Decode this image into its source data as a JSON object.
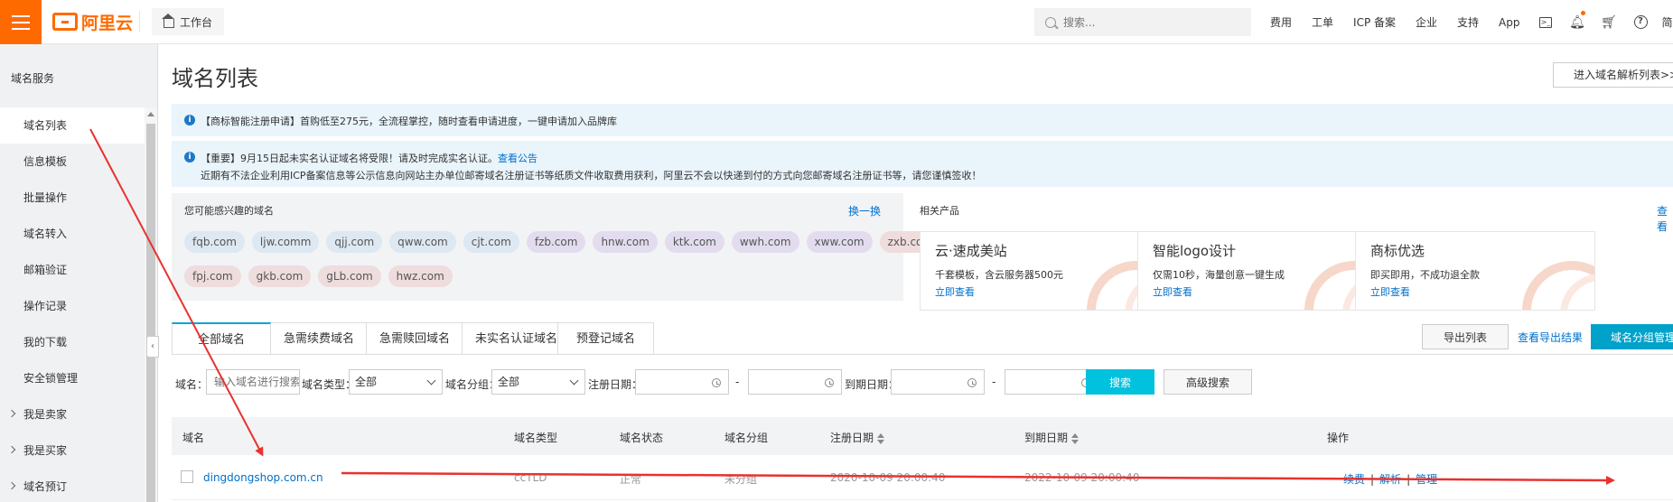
{
  "topbar": {
    "brand": "阿里云",
    "workbench": "工作台",
    "search_placeholder": "搜索...",
    "links": [
      "费用",
      "工单",
      "ICP 备案",
      "企业",
      "支持",
      "App"
    ],
    "lang": "简体",
    "accent_color": "#ff6a00"
  },
  "sidebar": {
    "title": "域名服务",
    "items": [
      {
        "label": "域名列表",
        "active": true,
        "group": false
      },
      {
        "label": "信息模板",
        "active": false,
        "group": false
      },
      {
        "label": "批量操作",
        "active": false,
        "group": false
      },
      {
        "label": "域名转入",
        "active": false,
        "group": false
      },
      {
        "label": "邮箱验证",
        "active": false,
        "group": false
      },
      {
        "label": "操作记录",
        "active": false,
        "group": false
      },
      {
        "label": "我的下载",
        "active": false,
        "group": false
      },
      {
        "label": "安全锁管理",
        "active": false,
        "group": false
      },
      {
        "label": "我是卖家",
        "active": false,
        "group": true
      },
      {
        "label": "我是买家",
        "active": false,
        "group": true
      },
      {
        "label": "域名预订",
        "active": false,
        "group": true
      }
    ]
  },
  "main": {
    "title": "域名列表",
    "dns_button": "进入域名解析列表>>",
    "notice1": {
      "text": "【商标智能注册申请】首购低至275元，全流程掌控，随时查看申请进度，一键申请加入品牌库"
    },
    "notice2": {
      "text": "【重要】9月15日起未实名认证域名将受限！请及时完成实名认证。",
      "link": "查看公告",
      "line2": "近期有不法企业利用ICP备案信息等公示信息向网站主办单位邮寄域名注册证书等纸质文件收取费用获利，阿里云不会以快递到付的方式向您邮寄域名注册证书等，请您谨慎签收！"
    },
    "suggest": {
      "title": "您可能感兴趣的域名",
      "swap": "换一换",
      "row1": [
        {
          "name": "fqb.com",
          "tone": "blue"
        },
        {
          "name": "ljw.comm",
          "tone": "blue"
        },
        {
          "name": "qjj.com",
          "tone": "blue"
        },
        {
          "name": "qww.com",
          "tone": "blue"
        },
        {
          "name": "cjt.com",
          "tone": "blue"
        },
        {
          "name": "fzb.com",
          "tone": "purple"
        },
        {
          "name": "hnw.com",
          "tone": "purple"
        },
        {
          "name": "ktk.com",
          "tone": "purple"
        },
        {
          "name": "wwh.com",
          "tone": "purple"
        },
        {
          "name": "xww.com",
          "tone": "purple"
        },
        {
          "name": "zxb.com",
          "tone": "pink"
        }
      ],
      "row2": [
        {
          "name": "fpj.com",
          "tone": "pink"
        },
        {
          "name": "gkb.com",
          "tone": "pink"
        },
        {
          "name": "gLb.com",
          "tone": "pink"
        },
        {
          "name": "hwz.com",
          "tone": "pink"
        }
      ]
    },
    "related": {
      "title": "相关产品",
      "more": "查看",
      "products": [
        {
          "name": "云·速成美站",
          "desc": "千套模板，含云服务器500元",
          "link": "立即查看"
        },
        {
          "name": "智能logo设计",
          "desc": "仅需10秒，海量创意一键生成",
          "link": "立即查看"
        },
        {
          "name": "商标优选",
          "desc": "即买即用，不成功退全款",
          "link": "立即查看"
        }
      ]
    },
    "tabs": [
      "全部域名",
      "急需续费域名",
      "急需赎回域名",
      "未实名认证域名",
      "预登记域名"
    ],
    "actions": {
      "export": "导出列表",
      "export_result": "查看导出结果",
      "group": "域名分组管理"
    },
    "filters": {
      "domain_label": "域名：",
      "domain_placeholder": "输入域名进行搜索",
      "type_label": "域名类型：",
      "type_value": "全部",
      "group_label": "域名分组：",
      "group_value": "全部",
      "reg_date_label": "注册日期：",
      "exp_date_label": "到期日期：",
      "dash": "-",
      "search": "搜索",
      "advanced": "高级搜索"
    },
    "table": {
      "headers": {
        "domain": "域名",
        "type": "域名类型",
        "status": "域名状态",
        "group": "域名分组",
        "reg_date": "注册日期",
        "exp_date": "到期日期",
        "ops": "操作"
      },
      "row": {
        "domain": "dingdongshop.com.cn",
        "type": "ccTLD",
        "status": "正常",
        "group": "未分组",
        "reg_date": "2020-10-09 20:00:40",
        "exp_date": "2022-10-09 20:00:40",
        "op1": "续费",
        "op2": "解析",
        "op3": "管理"
      }
    }
  },
  "annotation_color": "#e8322f"
}
